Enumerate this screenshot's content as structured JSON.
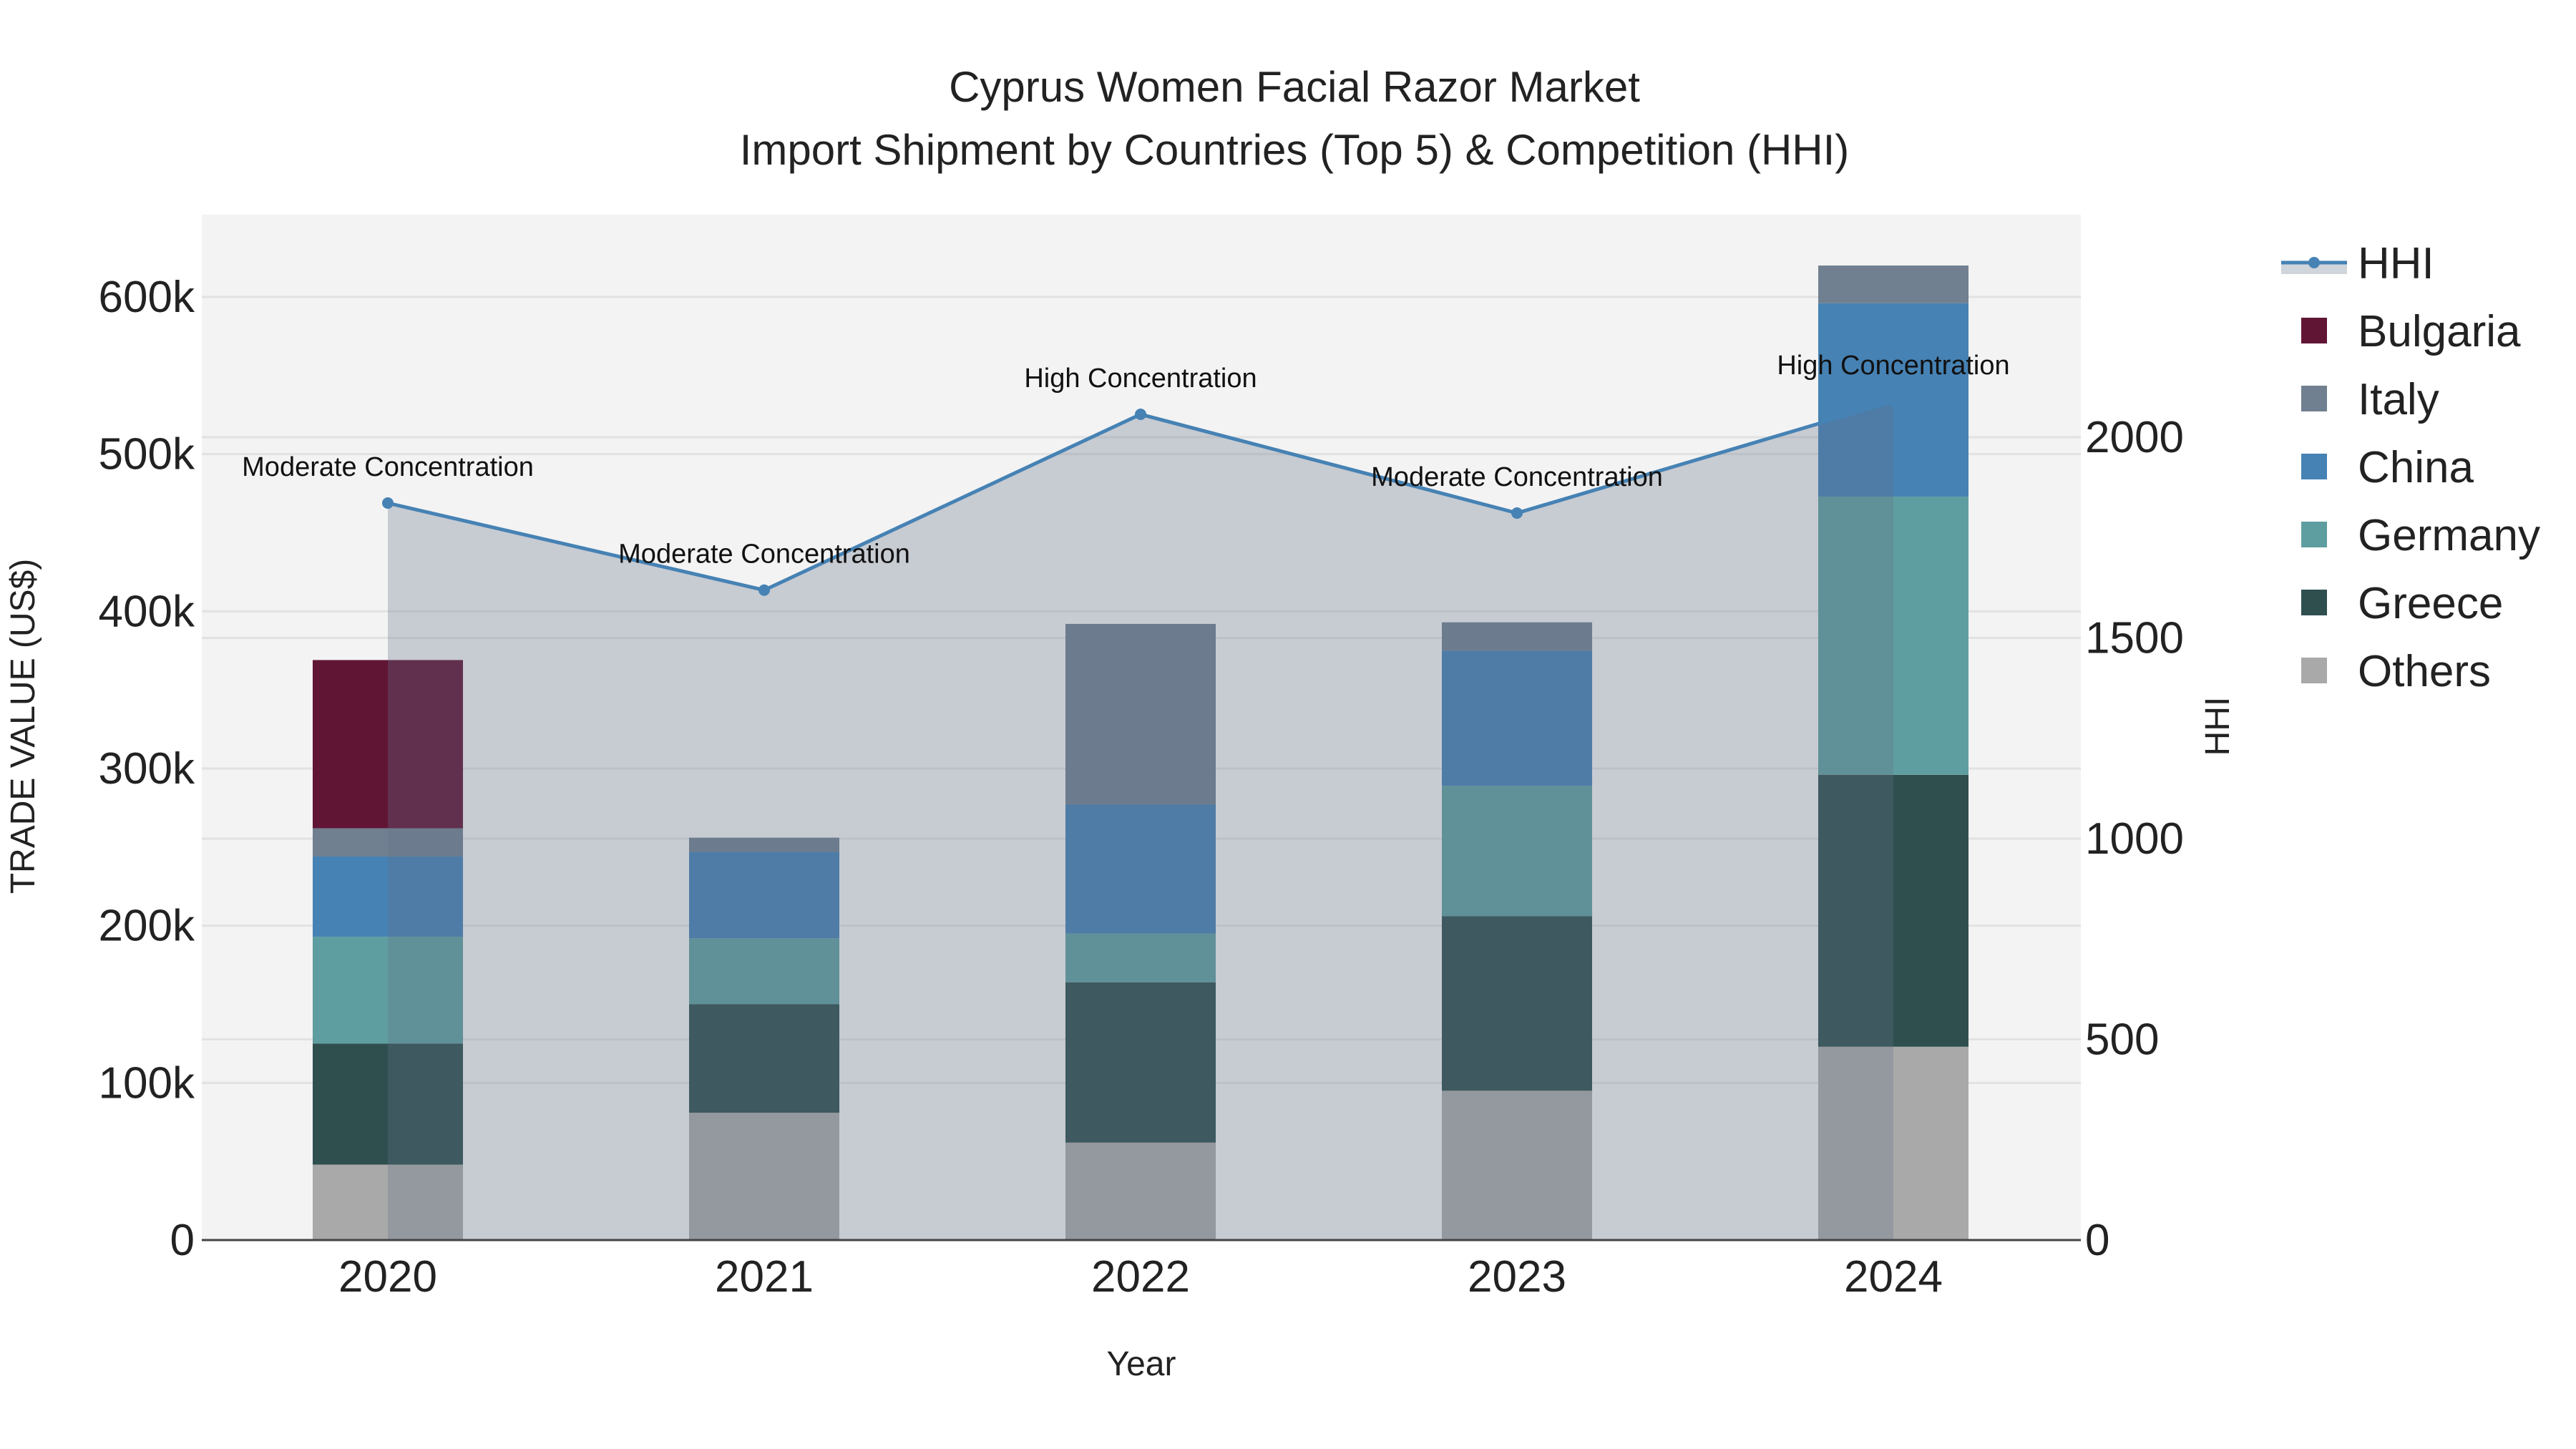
{
  "chart_data": {
    "type": "bar",
    "title": "Cyprus Women Facial Razor Market",
    "subtitle": "Import Shipment by Countries (Top 5) & Competition (HHI)",
    "xlabel": "Year",
    "ylabel": "TRADE VALUE (US$)",
    "y2label": "HHI",
    "categories": [
      "2020",
      "2021",
      "2022",
      "2023",
      "2024"
    ],
    "stacked": true,
    "ylim": [
      0,
      650000
    ],
    "y2lim": [
      0,
      2210
    ],
    "yticks": [
      0,
      100000,
      200000,
      300000,
      400000,
      500000,
      600000
    ],
    "ytick_labels": [
      "0",
      "100k",
      "200k",
      "300k",
      "400k",
      "500k",
      "600k"
    ],
    "y2ticks": [
      0,
      500,
      1000,
      1500,
      2000
    ],
    "y2tick_labels": [
      "0",
      "500",
      "1000",
      "1500",
      "2000"
    ],
    "grid": true,
    "legend_position": "right",
    "series": [
      {
        "name": "Others",
        "color": "#a9a9a9",
        "values": [
          48000,
          81000,
          62000,
          95000,
          123000
        ]
      },
      {
        "name": "Greece",
        "color": "#2f4f4f",
        "values": [
          77000,
          69000,
          102000,
          111000,
          173000
        ]
      },
      {
        "name": "Germany",
        "color": "#5f9ea0",
        "values": [
          68000,
          42000,
          31000,
          83000,
          177000
        ]
      },
      {
        "name": "China",
        "color": "#4682b4",
        "values": [
          51000,
          55000,
          82000,
          86000,
          123000
        ]
      },
      {
        "name": "Italy",
        "color": "#708090",
        "values": [
          18000,
          9000,
          115000,
          18000,
          24000
        ]
      },
      {
        "name": "Bulgaria",
        "color": "#611535",
        "values": [
          107000,
          0,
          0,
          0,
          0
        ]
      }
    ],
    "line_series": {
      "name": "HHI",
      "axis": "right",
      "color": "#4682b4",
      "values": [
        1836,
        1619,
        2057,
        1811,
        2089
      ],
      "annotations": [
        "Moderate Concentration",
        "Moderate Concentration",
        "High Concentration",
        "Moderate Concentration",
        "High Concentration"
      ]
    },
    "legend_order": [
      "HHI",
      "Bulgaria",
      "Italy",
      "China",
      "Germany",
      "Greece",
      "Others"
    ]
  }
}
